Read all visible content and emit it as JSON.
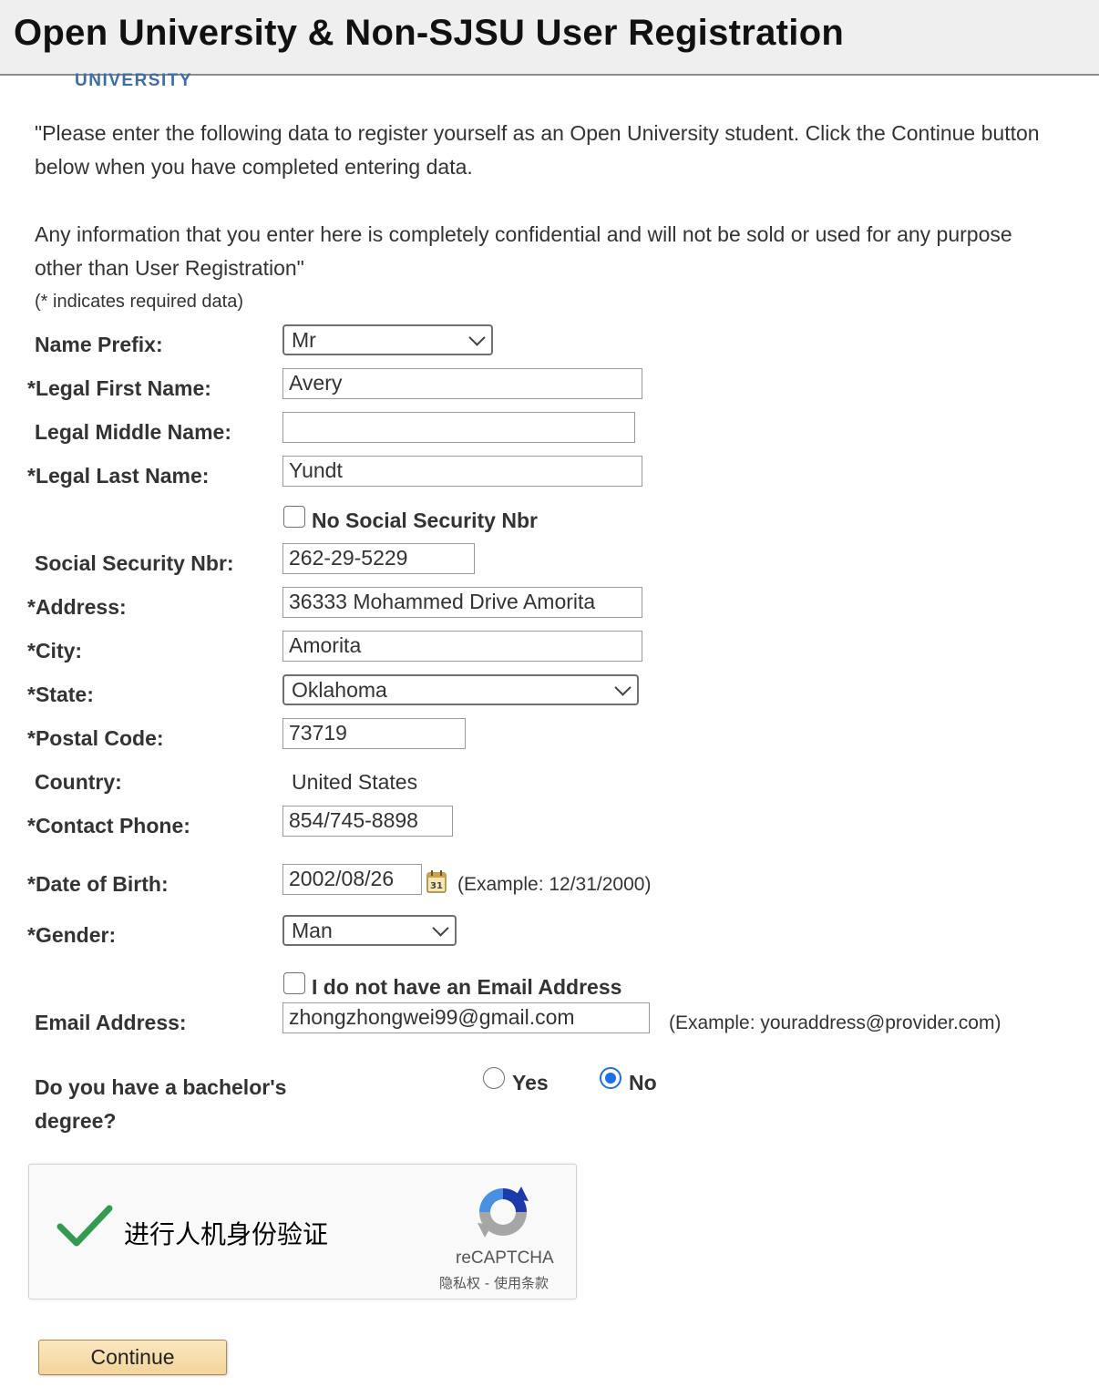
{
  "header": {
    "title": "Open University & Non-SJSU User Registration"
  },
  "logo": {
    "text": "UNIVERSITY"
  },
  "intro": {
    "paragraph1": "\"Please enter the following data to register yourself as an Open University student. Click the Continue button below when you have completed entering data.",
    "paragraph2": "Any information that you enter here is completely confidential and will not be sold or used for any purpose other than User Registration\"",
    "required_note": "(* indicates required data)"
  },
  "form": {
    "name_prefix": {
      "label": "Name Prefix:",
      "value": "Mr"
    },
    "first_name": {
      "label": "*Legal First Name:",
      "value": "Avery"
    },
    "middle_name": {
      "label": "Legal Middle Name:",
      "value": ""
    },
    "last_name": {
      "label": "*Legal Last Name:",
      "value": "Yundt"
    },
    "no_ssn": {
      "label": "No Social Security Nbr",
      "checked": false
    },
    "ssn": {
      "label": "Social Security Nbr:",
      "value": "262-29-5229"
    },
    "address": {
      "label": "*Address:",
      "value": "36333 Mohammed Drive Amorita"
    },
    "city": {
      "label": "*City:",
      "value": "Amorita"
    },
    "state": {
      "label": "*State:",
      "value": "Oklahoma"
    },
    "postal_code": {
      "label": "*Postal Code:",
      "value": "73719"
    },
    "country": {
      "label": "Country:",
      "value": "United States"
    },
    "phone": {
      "label": "*Contact Phone:",
      "value": "854/745-8898"
    },
    "dob": {
      "label": "*Date of Birth:",
      "value": "2002/08/26",
      "example": "(Example: 12/31/2000)",
      "icon": "calendar-icon"
    },
    "gender": {
      "label": "*Gender:",
      "value": "Man"
    },
    "no_email": {
      "label": "I do not have an Email Address",
      "checked": false
    },
    "email": {
      "label": "Email Address:",
      "value": "zhongzhongwei99@gmail.com",
      "example": "(Example: youraddress@provider.com)"
    },
    "bachelor": {
      "label_line1": "Do you have a bachelor's",
      "label_line2": "degree?",
      "options": [
        "Yes",
        "No"
      ],
      "selected": "No"
    }
  },
  "captcha": {
    "text": "进行人机身份验证",
    "brand": "reCAPTCHA",
    "terms": "隐私权 - 使用条款",
    "status": "verified",
    "check_color": "#339a4f"
  },
  "continue_button": {
    "label": "Continue"
  },
  "colors": {
    "accent": "#1f6fe5",
    "button": "#f3d49a"
  }
}
